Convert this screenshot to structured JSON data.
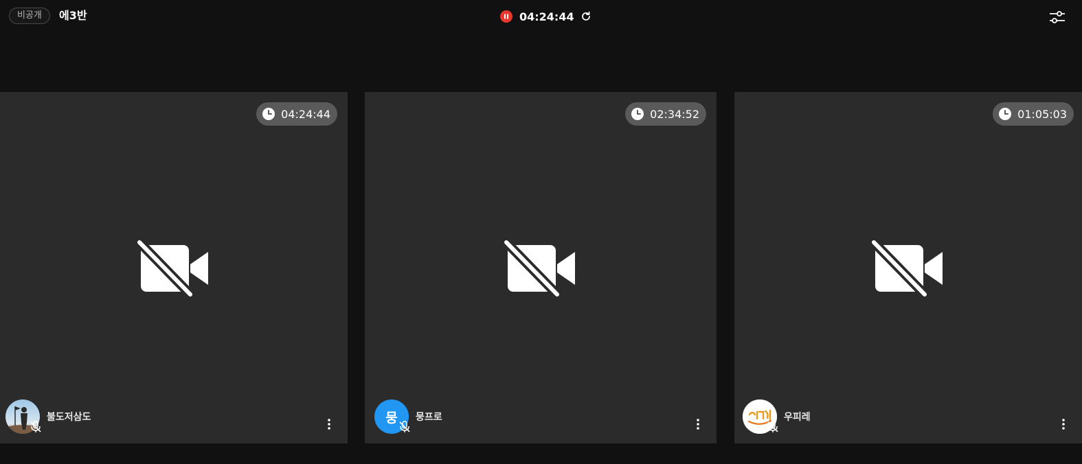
{
  "header": {
    "visibility_badge": "비공개",
    "room_title": "에3반",
    "session_time": "04:24:44",
    "status_color": "#e8382e",
    "icons": {
      "pause": "pause-icon",
      "refresh": "refresh-icon",
      "settings": "sliders-icon"
    }
  },
  "participants": [
    {
      "name": "불도저삼도",
      "timer": "04:24:44",
      "avatar_type": "photo",
      "camera": "off",
      "mic": "muted"
    },
    {
      "name": "뭉프로",
      "timer": "02:34:52",
      "avatar_type": "initial",
      "avatar_initial": "뭉",
      "avatar_color": "#2196f3",
      "camera": "off",
      "mic": "muted"
    },
    {
      "name": "우피레",
      "timer": "01:05:03",
      "avatar_type": "logo",
      "camera": "off",
      "mic": "muted"
    }
  ],
  "colors": {
    "background": "#111111",
    "tile": "#2b2b2b",
    "timer_pill": "#5a5a5a"
  }
}
